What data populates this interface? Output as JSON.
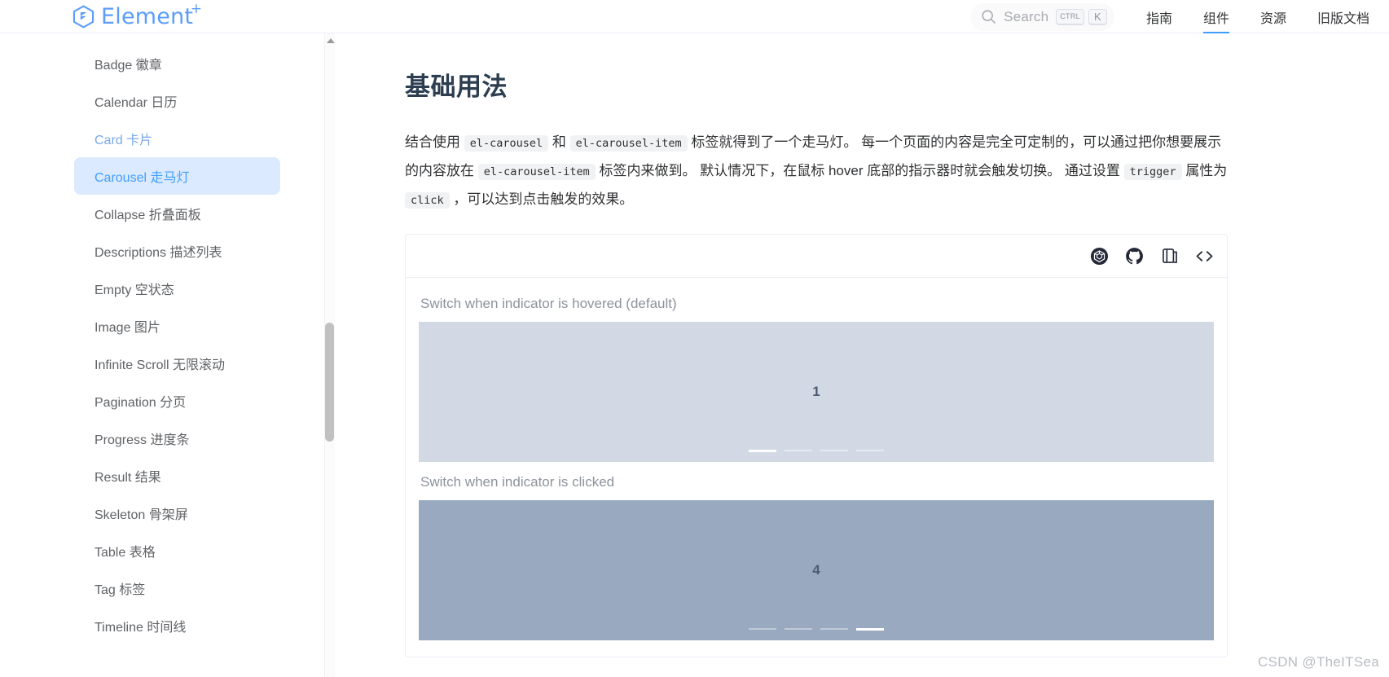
{
  "header": {
    "brand": {
      "name": "Element",
      "superscript": "+",
      "logo_icon": "element-plus-logo",
      "color": "#5c9dfb"
    },
    "search": {
      "label": "Search",
      "icon": "search-icon",
      "kbd_ctrl": "CTRL",
      "kbd_key": "K"
    },
    "nav": [
      {
        "label": "指南",
        "active": false
      },
      {
        "label": "组件",
        "active": true
      },
      {
        "label": "资源",
        "active": false
      },
      {
        "label": "旧版文档",
        "active": false
      }
    ],
    "accent_color": "#409eff"
  },
  "sidebar": {
    "items": [
      {
        "label": "Badge 徽章",
        "state": "default"
      },
      {
        "label": "Calendar 日历",
        "state": "default"
      },
      {
        "label": "Card 卡片",
        "state": "visited"
      },
      {
        "label": "Carousel 走马灯",
        "state": "active"
      },
      {
        "label": "Collapse 折叠面板",
        "state": "default"
      },
      {
        "label": "Descriptions 描述列表",
        "state": "default"
      },
      {
        "label": "Empty 空状态",
        "state": "default"
      },
      {
        "label": "Image 图片",
        "state": "default"
      },
      {
        "label": "Infinite Scroll 无限滚动",
        "state": "default"
      },
      {
        "label": "Pagination 分页",
        "state": "default"
      },
      {
        "label": "Progress 进度条",
        "state": "default"
      },
      {
        "label": "Result 结果",
        "state": "default"
      },
      {
        "label": "Skeleton 骨架屏",
        "state": "default"
      },
      {
        "label": "Table 表格",
        "state": "default"
      },
      {
        "label": "Tag 标签",
        "state": "default"
      },
      {
        "label": "Timeline 时间线",
        "state": "default"
      }
    ],
    "active_bg": "#dbeafe",
    "active_color": "#409eff"
  },
  "main": {
    "title": "基础用法",
    "description": {
      "part1": "结合使用",
      "code1": "el-carousel",
      "part2": "和",
      "code2": "el-carousel-item",
      "part3": "标签就得到了一个走马灯。 每一个页面的内容是完全可定制的，可以通过把你想要展示的内容放在",
      "code3": "el-carousel-item",
      "part4": "标签内来做到。 默认情况下，在鼠标 hover 底部的指示器时就会触发切换。 通过设置",
      "code4": "trigger",
      "part5": "属性为",
      "code5": "click",
      "part6": "，可以达到点击触发的效果。"
    },
    "demo": {
      "toolbar": [
        {
          "icon": "codesandbox-icon",
          "name": "open-in-codesandbox"
        },
        {
          "icon": "github-icon",
          "name": "open-in-github"
        },
        {
          "icon": "copy-icon",
          "name": "copy-code"
        },
        {
          "icon": "code-brackets-icon",
          "name": "toggle-source"
        }
      ],
      "carousels": [
        {
          "label": "Switch when indicator is hovered (default)",
          "slide_text": "1",
          "indicator_count": 4,
          "active_index": 0,
          "bg_color": "#d3d9e4"
        },
        {
          "label": "Switch when indicator is clicked",
          "slide_text": "4",
          "indicator_count": 4,
          "active_index": 3,
          "bg_color": "#99a9c0"
        }
      ]
    }
  },
  "watermark": "CSDN @TheITSea"
}
